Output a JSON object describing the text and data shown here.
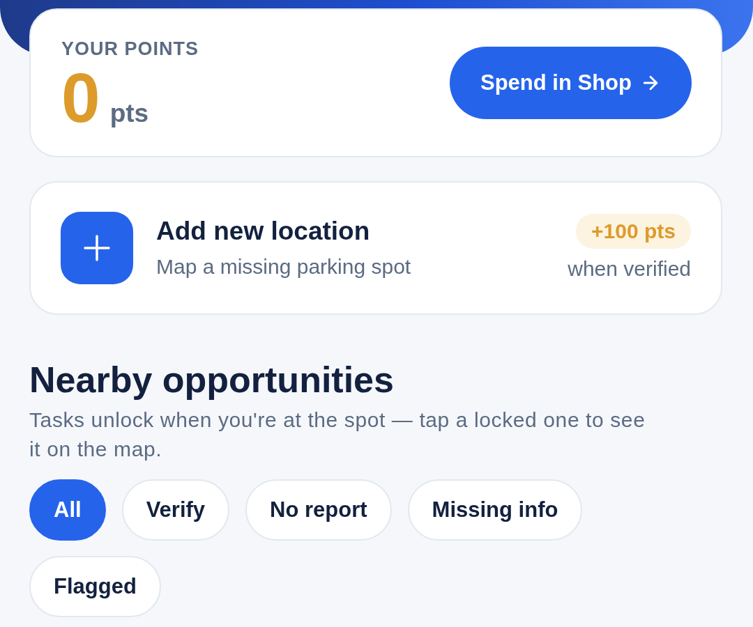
{
  "points_card": {
    "label": "YOUR POINTS",
    "value": "0",
    "unit": "pts",
    "button": {
      "label": "Spend in Shop"
    }
  },
  "add_location": {
    "title": "Add new location",
    "subtitle": "Map a missing parking spot",
    "badge": "+100 pts",
    "note": "when verified"
  },
  "section": {
    "title": "Nearby opportunities",
    "description": "Tasks unlock when you're at the spot — tap a locked one to see it on the map."
  },
  "filters": [
    {
      "label": "All",
      "selected": true
    },
    {
      "label": "Verify",
      "selected": false
    },
    {
      "label": "No report",
      "selected": false
    },
    {
      "label": "Missing info",
      "selected": false
    },
    {
      "label": "Flagged",
      "selected": false
    }
  ]
}
